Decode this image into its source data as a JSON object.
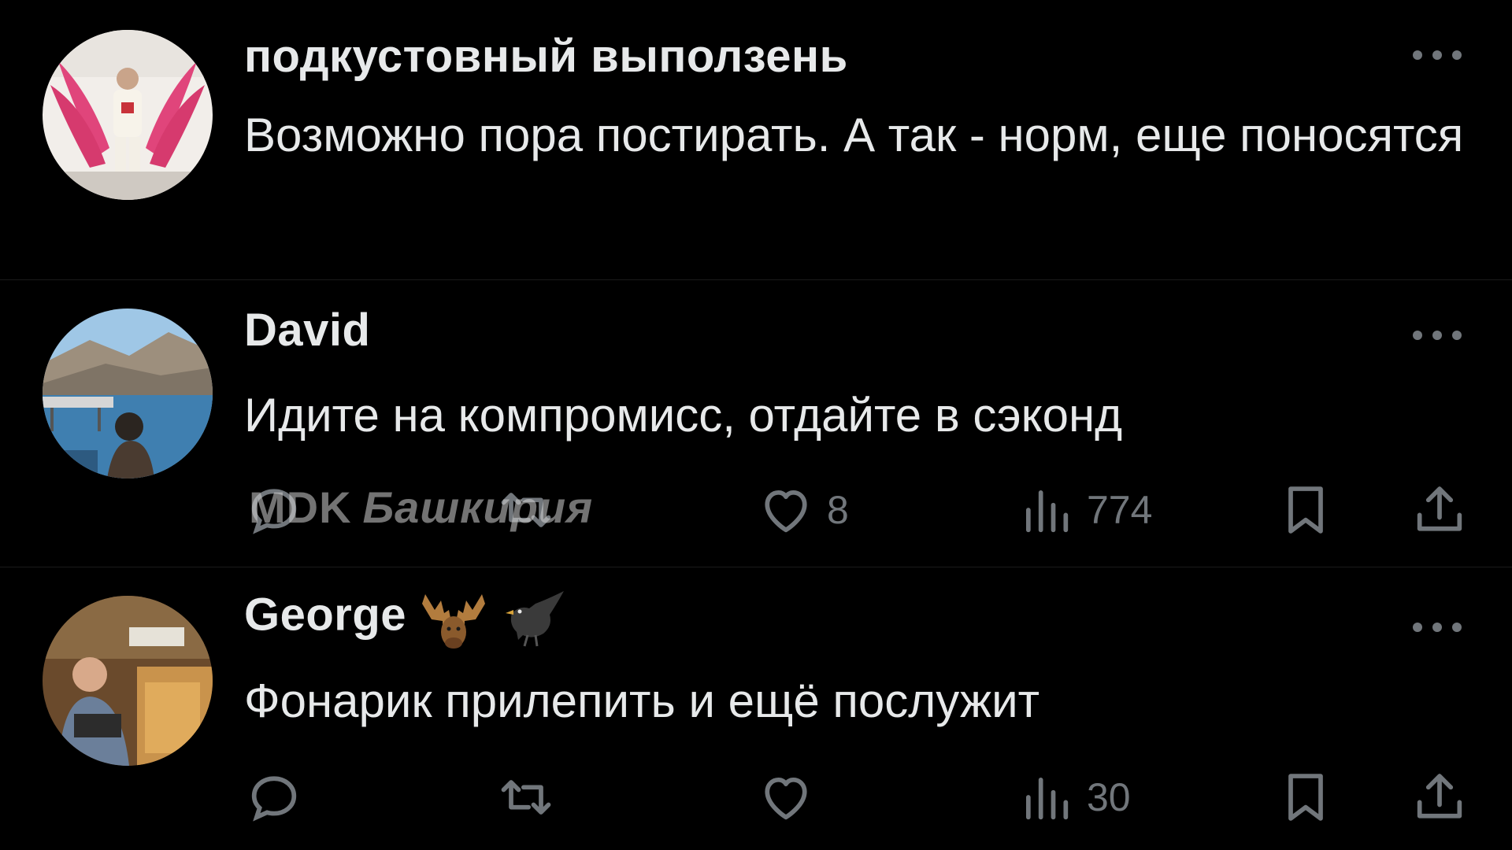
{
  "posts": [
    {
      "author": "подкустовный выползень",
      "text": "Возможно пора постирать. А так - норм, еще поносятся"
    },
    {
      "author": "David",
      "text": "Идите на компромисс, отдайте в сэконд",
      "actions": {
        "likes": "8",
        "views": "774"
      }
    },
    {
      "author": "George",
      "author_emojis": [
        "moose-emoji",
        "black-bird-emoji"
      ],
      "text": "Фонарик прилепить и ещё послужит",
      "actions": {
        "views": "30"
      }
    }
  ],
  "watermark": {
    "brand": "MDK",
    "region": "Башкирия"
  },
  "colors": {
    "background": "#000000",
    "text": "#e7e9ea",
    "muted": "#71767b"
  },
  "icons": [
    "reply-icon",
    "repost-icon",
    "like-icon",
    "views-icon",
    "bookmark-icon",
    "share-icon",
    "more-icon"
  ]
}
